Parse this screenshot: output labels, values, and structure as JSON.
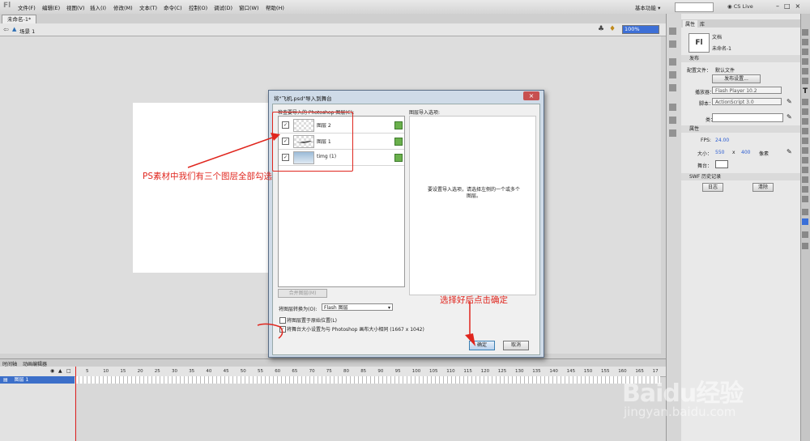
{
  "menubar": {
    "logo": "Fl",
    "items": [
      "文件(F)",
      "编辑(E)",
      "视图(V)",
      "插入(I)",
      "修改(M)",
      "文本(T)",
      "命令(C)",
      "控制(O)",
      "调试(D)",
      "窗口(W)",
      "帮助(H)"
    ],
    "workspace": "基本功能 ▾",
    "cs_live": "CS Live",
    "window_controls": "–□×"
  },
  "document": {
    "tab": "未命名-1*",
    "scene": "场景 1",
    "zoom": "100%"
  },
  "timeline": {
    "tabs": [
      "时间轴",
      "动画编辑器"
    ],
    "layer_name": "图层 1",
    "frame_numbers": [
      "5",
      "10",
      "15",
      "20",
      "25",
      "30",
      "35",
      "40",
      "45",
      "50",
      "55",
      "60",
      "65",
      "70",
      "75",
      "80",
      "85",
      "90",
      "95",
      "100",
      "105",
      "110",
      "115",
      "120",
      "125",
      "130",
      "135",
      "140",
      "145",
      "150",
      "155",
      "160",
      "165",
      "17"
    ]
  },
  "properties": {
    "tabs": [
      "属性",
      "库"
    ],
    "doc_type": "文档",
    "doc_name": "未命名-1",
    "publish_section": "发布",
    "profile_label": "配置文件：",
    "profile_value": "默认文件",
    "publish_settings_button": "发布设置...",
    "player_label": "播放器：",
    "player_value": "Flash Player 10.2",
    "script_label": "脚本：",
    "script_value": "ActionScript 3.0",
    "class_label": "类：",
    "attributes_section": "属性",
    "fps_label": "FPS:",
    "fps_value": "24.00",
    "size_label": "大小：",
    "width_value": "550",
    "x_sep": "x",
    "height_value": "400",
    "unit": "像素",
    "stage_label": "舞台：",
    "swf_history_section": "SWF 历史记录",
    "log_button": "日志",
    "clear_button": "清除"
  },
  "dialog": {
    "title": "将\"飞机.psd\"导入到舞台",
    "close": "×",
    "layers_label": "检查要导入的 Photoshop 图层(C):",
    "layers": [
      {
        "name": "图层 2",
        "checked": "✓"
      },
      {
        "name": "图层 1",
        "checked": "✓"
      },
      {
        "name": "timg (1)",
        "checked": "✓"
      }
    ],
    "merge_button": "合并图层(M)",
    "options_label": "图层导入选项:",
    "options_message": "要设置导入选项，请选择左侧的一个或多个图层。",
    "convert_label": "将图层转换为(O):",
    "convert_value": "Flash 图层",
    "checkbox1_label": "将图层置于原始位置(L)",
    "checkbox2_label": "将舞台大小设置为与 Photoshop 画布大小相同 (1667 x 1042)",
    "checkbox2_checked": "✓",
    "ok_button": "确定",
    "cancel_button": "取消"
  },
  "annotations": {
    "text1": "PS素材中我们有三个图层全部勾选",
    "text2": "选择好后点击确定",
    "color": "#e0261e"
  },
  "watermark": {
    "logo": "Baidu经验",
    "url": "jingyan.baidu.com"
  }
}
